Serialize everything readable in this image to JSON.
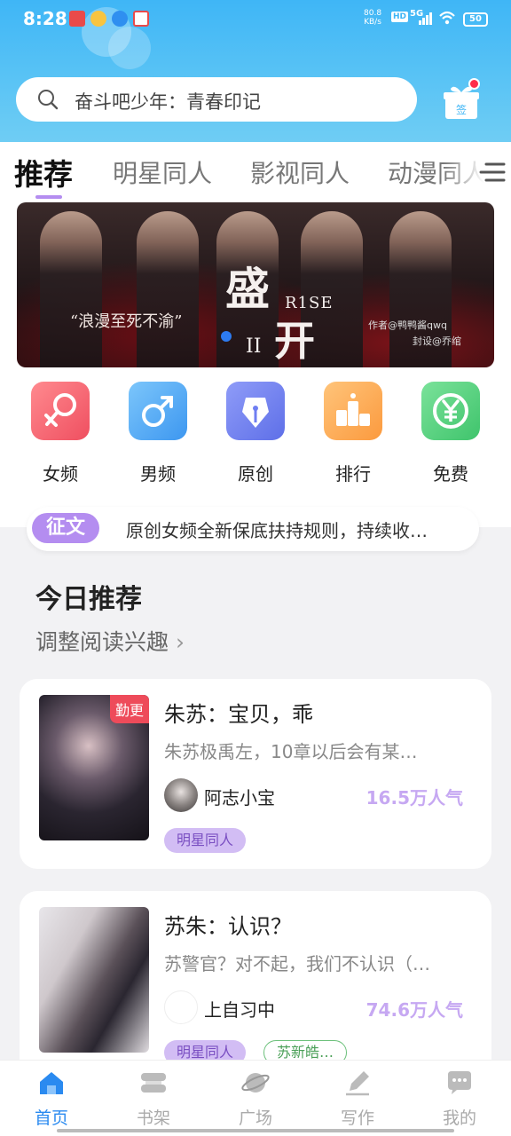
{
  "status": {
    "time": "8:28",
    "net_speed": "80.8\nKB/s",
    "hd": "HD",
    "signal": "5G",
    "battery": "50"
  },
  "search": {
    "placeholder": "奋斗吧少年：青春印记"
  },
  "checkin": {
    "label": "签"
  },
  "tabs": [
    "推荐",
    "明星同人",
    "影视同人",
    "动漫同人"
  ],
  "banner": {
    "quote": "“浪漫至死不渝”",
    "title_top": "盛",
    "title_bottom": "开",
    "numeral": "II",
    "en": "R1SE",
    "author": "作者@鸭鸭酱qwq",
    "cover_credit": "封设@乔绾"
  },
  "categories": [
    {
      "label": "女频",
      "icon": "female-icon",
      "color": "#f2626c"
    },
    {
      "label": "男频",
      "icon": "male-icon",
      "color": "#42a6f5"
    },
    {
      "label": "原创",
      "icon": "pen-nib-icon",
      "color": "#6f7ef2"
    },
    {
      "label": "排行",
      "icon": "podium-icon",
      "color": "#fba44a"
    },
    {
      "label": "免费",
      "icon": "yen-icon",
      "color": "#4ccf7a"
    }
  ],
  "notice": {
    "badge": "征文",
    "text": "原创女频全新保底扶持规则，持续收…"
  },
  "section": {
    "title": "今日推荐",
    "subtitle": "调整阅读兴趣",
    "subtitle_chevron": "›"
  },
  "books": [
    {
      "badge": "勤更",
      "title": "朱苏：宝贝，乖",
      "desc": "朱苏极禹左，10章以后会有某…",
      "author": "阿志小宝",
      "popularity": "16.5万人气",
      "tags": [
        "明星同人"
      ]
    },
    {
      "badge": "",
      "title": "苏朱：认识？",
      "desc": "苏警官？对不起，我们不认识（…",
      "author": "上自习中",
      "popularity": "74.6万人气",
      "tags": [
        "明星同人",
        "苏新皓…"
      ]
    }
  ],
  "bottom_nav": [
    {
      "label": "首页",
      "icon": "home-icon",
      "active": true
    },
    {
      "label": "书架",
      "icon": "bookshelf-icon",
      "active": false
    },
    {
      "label": "广场",
      "icon": "planet-icon",
      "active": false
    },
    {
      "label": "写作",
      "icon": "pencil-icon",
      "active": false
    },
    {
      "label": "我的",
      "icon": "chat-bubble-icon",
      "active": false
    }
  ],
  "colors": {
    "accent": "#2a8af0",
    "header": "#3fb6f6",
    "purple": "#b48df0"
  }
}
